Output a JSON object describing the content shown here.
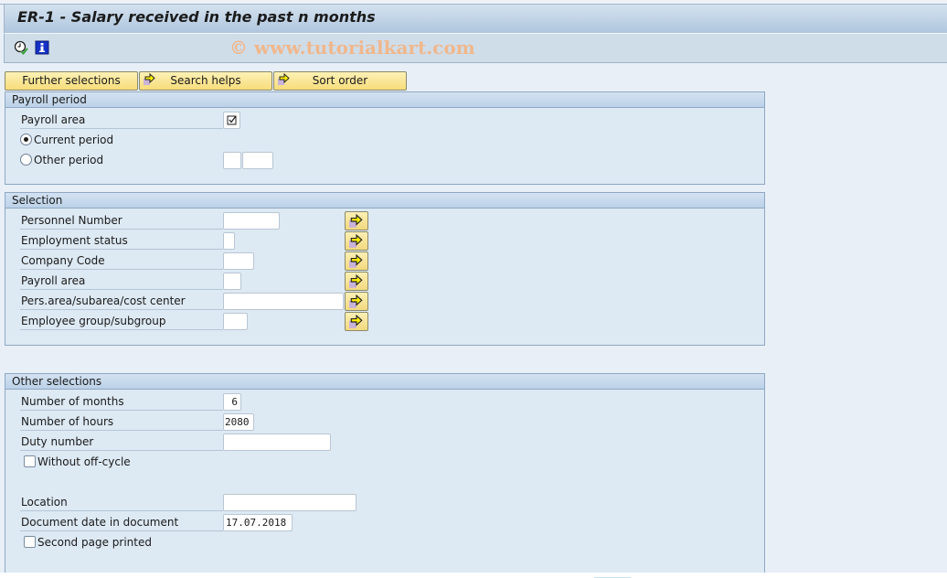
{
  "window": {
    "title": "ER-1 - Salary received in the past n months",
    "watermark": "© www.tutorialkart.com"
  },
  "toolbar": {
    "icons": [
      {
        "name": "execute-clock-icon",
        "tooltip": "Execute"
      },
      {
        "name": "info-icon",
        "tooltip": "Information"
      }
    ]
  },
  "selection_buttons": {
    "further_selections": "Further selections",
    "search_helps": "Search helps",
    "sort_order": "Sort order"
  },
  "payroll_period": {
    "title": "Payroll period",
    "payroll_area_label": "Payroll area",
    "payroll_area_checked": true,
    "current_period_label": "Current period",
    "current_period_selected": true,
    "other_period_label": "Other period",
    "other_period_selected": false,
    "other_period_value1": "",
    "other_period_value2": ""
  },
  "selection": {
    "title": "Selection",
    "fields": [
      {
        "label": "Personnel Number",
        "value": ""
      },
      {
        "label": "Employment status",
        "value": ""
      },
      {
        "label": "Company Code",
        "value": ""
      },
      {
        "label": "Payroll area",
        "value": ""
      },
      {
        "label": "Pers.area/subarea/cost center",
        "value": ""
      },
      {
        "label": "Employee group/subgroup",
        "value": ""
      }
    ]
  },
  "other_selections": {
    "title": "Other selections",
    "number_of_months_label": "Number of months",
    "number_of_months": "6",
    "number_of_hours_label": "Number of hours",
    "number_of_hours": "2080",
    "duty_number_label": "Duty number",
    "duty_number": "",
    "without_off_cycle_label": "Without off-cycle",
    "without_off_cycle_checked": false,
    "location_label": "Location",
    "location": "",
    "document_date_label": "Document date in document",
    "document_date": "17.07.2018",
    "second_page_printed_label": "Second page printed",
    "second_page_printed_checked": false
  }
}
